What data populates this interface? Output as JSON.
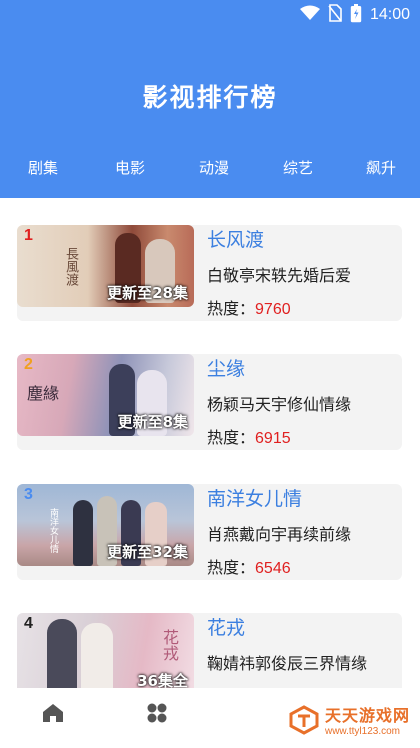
{
  "status_bar": {
    "time": "14:00",
    "icons": [
      "wifi-icon",
      "no-sim-icon",
      "battery-icon"
    ]
  },
  "header": {
    "title": "影视排行榜"
  },
  "tabs": [
    {
      "label": "剧集"
    },
    {
      "label": "电影"
    },
    {
      "label": "动漫"
    },
    {
      "label": "综艺"
    },
    {
      "label": "飙升"
    }
  ],
  "list": {
    "heat_label": "热度：",
    "items": [
      {
        "rank": "1",
        "title": "长风渡",
        "desc": "白敬亭宋轶先婚后爱",
        "heat": "9760",
        "episode": "更新至28集",
        "thumb_text": "長風渡",
        "rank_color": "#e02020"
      },
      {
        "rank": "2",
        "title": "尘缘",
        "desc": "杨颖马天宇修仙情缘",
        "heat": "6915",
        "episode": "更新至8集",
        "thumb_text": "塵緣",
        "rank_color": "#f0a020"
      },
      {
        "rank": "3",
        "title": "南洋女儿情",
        "desc": "肖燕戴向宇再续前缘",
        "heat": "6546",
        "episode": "更新至32集",
        "thumb_text": "南洋女儿情",
        "rank_color": "#4a8cf0"
      },
      {
        "rank": "4",
        "title": "花戎",
        "desc": "鞠婧祎郭俊辰三界情缘",
        "heat": "",
        "episode": "36集全",
        "thumb_text": "花戎",
        "rank_color": "#222222"
      }
    ]
  },
  "bottom_nav": {
    "items": [
      "home-icon",
      "grid-icon"
    ]
  },
  "watermark": {
    "name": "天天游戏网",
    "url": "www.ttyl123.com"
  },
  "colors": {
    "primary": "#4a8cf0",
    "title_blue": "#3b7fe0",
    "heat_red": "#e02020"
  }
}
